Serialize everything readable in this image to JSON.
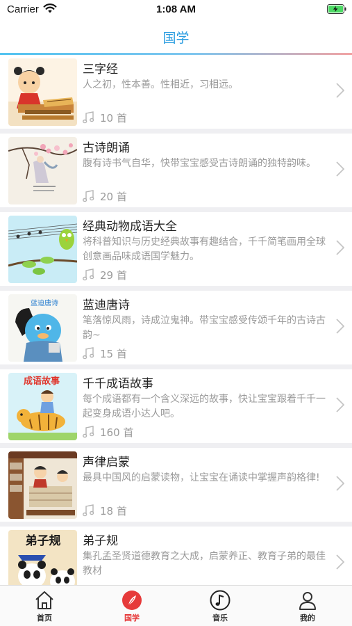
{
  "status_bar": {
    "carrier": "Carrier",
    "time": "1:08 AM"
  },
  "nav": {
    "title": "国学"
  },
  "items": [
    {
      "title": "三字经",
      "desc": "人之初，性本善。性相近，习相远。",
      "count": "10 首"
    },
    {
      "title": "古诗朗诵",
      "desc": "腹有诗书气自华，快带宝宝感受古诗朗诵的独特韵味。",
      "count": "20 首"
    },
    {
      "title": "经典动物成语大全",
      "desc": "将科普知识与历史经典故事有趣结合，千千简笔画用全球创意画品味成语国学魅力。",
      "count": "29 首"
    },
    {
      "title": "蓝迪唐诗",
      "desc": "笔落惊风雨，诗成泣鬼神。带宝宝感受传颂千年的古诗古韵~",
      "count": "15 首"
    },
    {
      "title": "千千成语故事",
      "desc": "每个成语都有一个含义深远的故事，快让宝宝跟着千千一起变身成语小达人吧。",
      "count": "160 首"
    },
    {
      "title": "声律启蒙",
      "desc": "最具中国风的启蒙读物，让宝宝在诵读中掌握声韵格律!",
      "count": "18 首"
    },
    {
      "title": "弟子规",
      "desc": "集孔孟圣贤道德教育之大成，启蒙养正、教育子弟的最佳教材",
      "count": ""
    }
  ],
  "thumb_text": {
    "item4": "蓝迪唐诗",
    "item5": "成语故事",
    "item7": "弟子规"
  },
  "tabs": [
    {
      "label": "首页",
      "icon": "home-icon"
    },
    {
      "label": "国学",
      "icon": "feather-icon"
    },
    {
      "label": "音乐",
      "icon": "music-note-icon"
    },
    {
      "label": "我的",
      "icon": "user-icon"
    }
  ],
  "colors": {
    "accent": "#2b9de0",
    "active_tab": "#e63a3a",
    "separator": "#efeff2"
  }
}
